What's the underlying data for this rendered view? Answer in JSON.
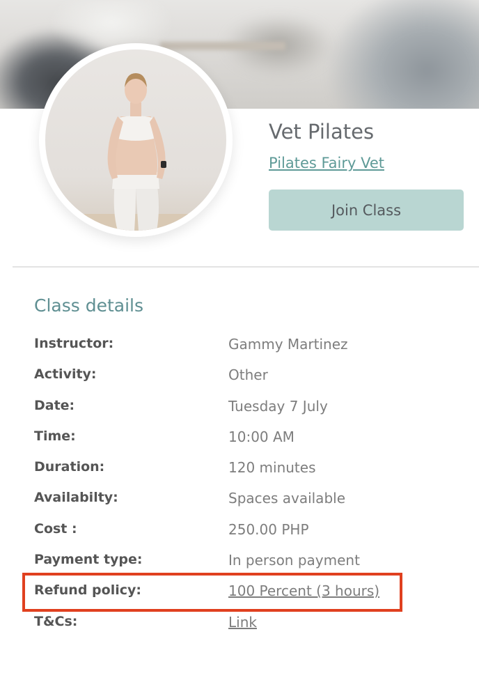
{
  "class": {
    "title": "Vet Pilates",
    "studio_link": "Pilates Fairy Vet",
    "join_label": "Join Class"
  },
  "details": {
    "title": "Class details",
    "rows": [
      {
        "label": "Instructor:",
        "value": "Gammy Martinez"
      },
      {
        "label": "Activity:",
        "value": "Other"
      },
      {
        "label": "Date:",
        "value": "Tuesday 7 July"
      },
      {
        "label": "Time:",
        "value": "10:00 AM"
      },
      {
        "label": "Duration:",
        "value": "120 minutes"
      },
      {
        "label": "Availabilty:",
        "value": "Spaces available"
      },
      {
        "label": "Cost :",
        "value": "250.00 PHP"
      },
      {
        "label": "Payment type:",
        "value": "In person payment"
      },
      {
        "label": "Refund policy:",
        "value": "100 Percent (3 hours)"
      },
      {
        "label": "T&Cs:",
        "value": "Link"
      }
    ]
  },
  "colors": {
    "accent": "#5f8f92",
    "button": "#b9d6d2",
    "highlight": "#e0401f"
  }
}
